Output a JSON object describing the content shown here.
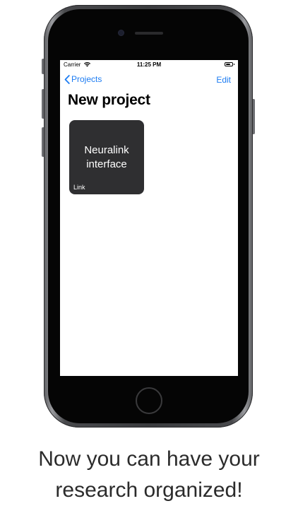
{
  "status_bar": {
    "carrier": "Carrier",
    "time": "11:25 PM",
    "wifi_icon": "wifi-icon",
    "battery_icon": "battery-icon"
  },
  "nav": {
    "back_label": "Projects",
    "back_icon": "chevron-left-icon",
    "edit_label": "Edit",
    "accent_color": "#1d7cf2"
  },
  "page": {
    "title": "New project"
  },
  "cards": [
    {
      "title_line1": "Neuralink",
      "title_line2": "interface",
      "subtitle": "Link",
      "background": "#2f2f31"
    }
  ],
  "caption": {
    "line1": "Now you can have your",
    "line2": "research organized!"
  }
}
